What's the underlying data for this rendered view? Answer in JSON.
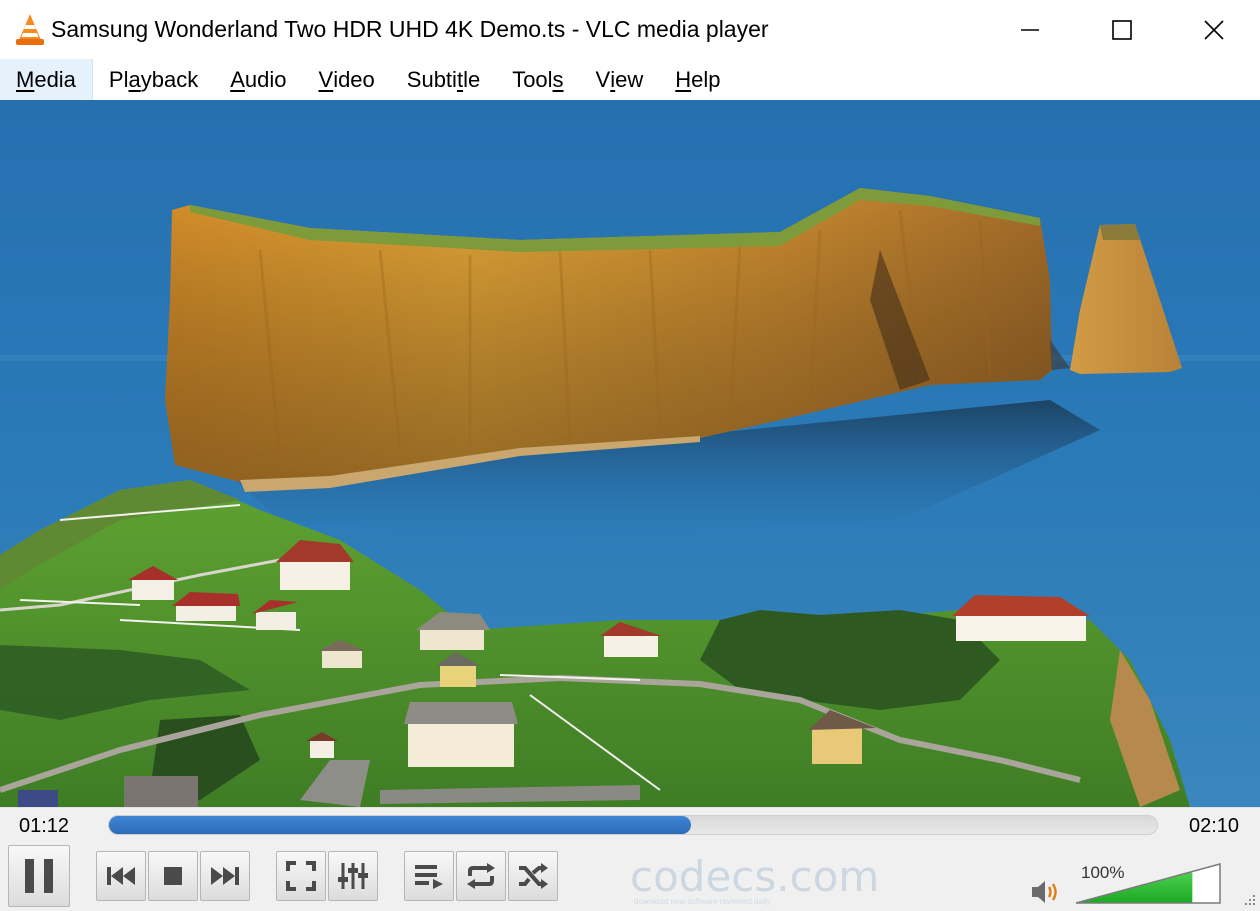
{
  "window": {
    "title": "Samsung Wonderland Two HDR UHD 4K Demo.ts - VLC media player",
    "app_icon": "vlc-cone-icon",
    "controls": [
      "minimize-icon",
      "maximize-icon",
      "close-icon"
    ]
  },
  "menu": {
    "items": [
      {
        "pre": "",
        "acc": "M",
        "post": "edia"
      },
      {
        "pre": "Pl",
        "acc": "a",
        "post": "yback"
      },
      {
        "pre": "",
        "acc": "A",
        "post": "udio"
      },
      {
        "pre": "",
        "acc": "V",
        "post": "ideo"
      },
      {
        "pre": "Subti",
        "acc": "t",
        "post": "le"
      },
      {
        "pre": "Tool",
        "acc": "s",
        "post": ""
      },
      {
        "pre": "V",
        "acc": "i",
        "post": "ew"
      },
      {
        "pre": "",
        "acc": "H",
        "post": "elp"
      }
    ],
    "active_index": 0
  },
  "player": {
    "elapsed": "01:12",
    "total": "02:10",
    "progress_fraction": 0.555,
    "volume_label": "100%",
    "volume_fraction": 0.78,
    "watermark": "codecs.com",
    "watermark_sub": "download new software reviewed daily"
  },
  "buttons": [
    "pause-icon",
    "previous-icon",
    "stop-icon",
    "next-icon",
    "fullscreen-icon",
    "extended-settings-icon",
    "playlist-icon",
    "loop-icon",
    "shuffle-icon"
  ],
  "colors": {
    "accent": "#2b6cb8",
    "menu_active": "#e5f1fb",
    "volume_green": "#22c02a"
  }
}
